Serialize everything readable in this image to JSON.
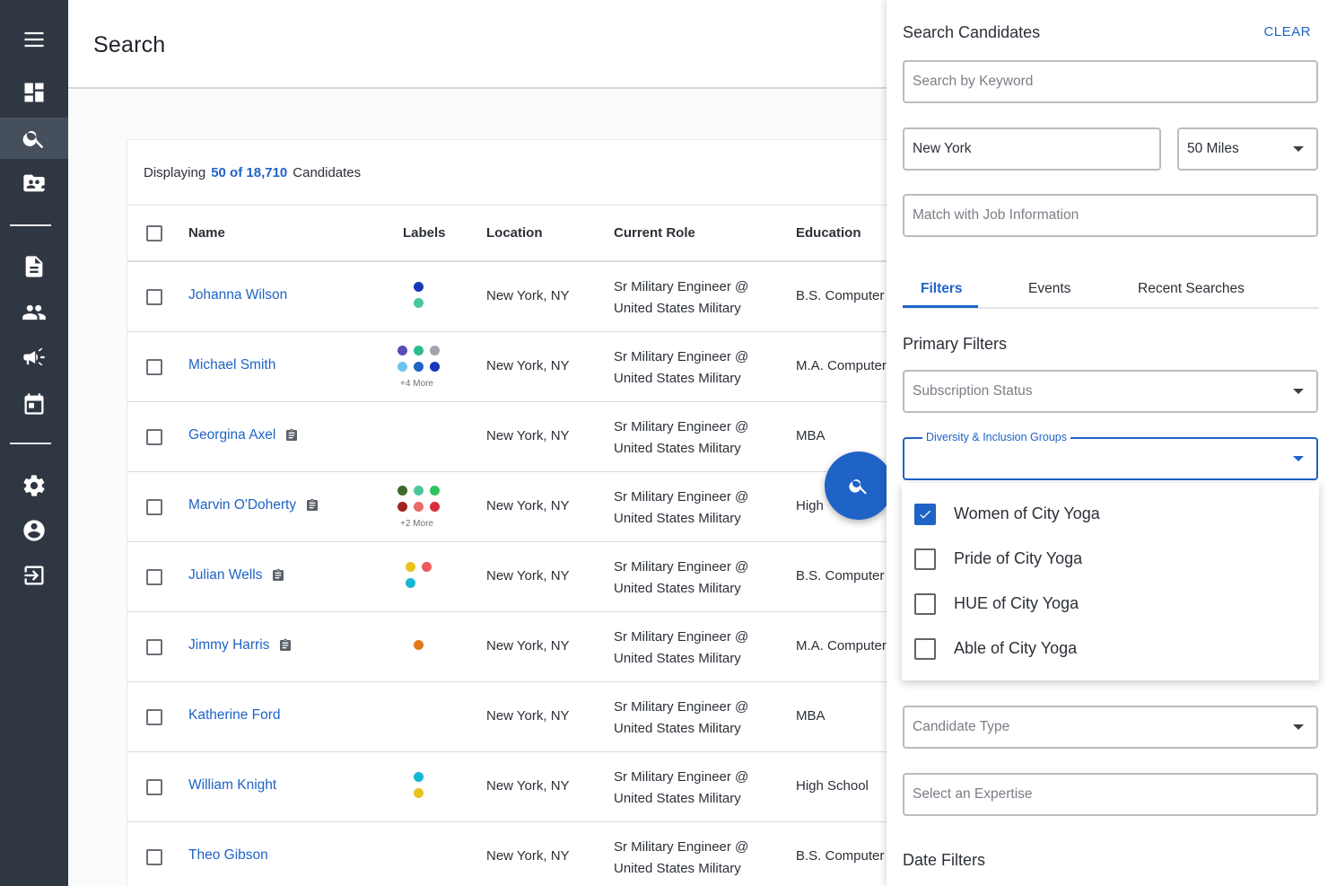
{
  "page": {
    "title": "Search"
  },
  "sidebar": {
    "items": [
      {
        "name": "menu-icon"
      },
      {
        "name": "dashboard-icon"
      },
      {
        "name": "search-icon",
        "active": true
      },
      {
        "name": "folder-people-icon"
      },
      {
        "name": "document-icon"
      },
      {
        "name": "people-icon"
      },
      {
        "name": "megaphone-icon"
      },
      {
        "name": "calendar-icon"
      },
      {
        "name": "gear-icon"
      },
      {
        "name": "account-icon"
      },
      {
        "name": "logout-icon"
      }
    ]
  },
  "table": {
    "displaying_prefix": "Displaying",
    "count": "50 of 18,710",
    "displaying_suffix": "Candidates",
    "headers": {
      "name": "Name",
      "labels": "Labels",
      "location": "Location",
      "role": "Current Role",
      "education": "Education"
    },
    "rows": [
      {
        "name": "Johanna Wilson",
        "note": false,
        "location": "New York, NY",
        "role1": "Sr Military Engineer @",
        "role2": "United States Military",
        "education": "B.S. Computer",
        "labels": [
          "#1838b8",
          "#4bc79a"
        ],
        "more": ""
      },
      {
        "name": "Michael Smith",
        "note": false,
        "location": "New York, NY",
        "role1": "Sr Military Engineer @",
        "role2": "United States Military",
        "education": "M.A. Computer",
        "labels": [
          "#5b4bb7",
          "#2bbd8f",
          "#a3a3ad",
          "#6bc4ee",
          "#1f63c6",
          "#1838b8"
        ],
        "more": "+4 More"
      },
      {
        "name": "Georgina Axel",
        "note": true,
        "location": "New York, NY",
        "role1": "Sr Military Engineer @",
        "role2": "United States Military",
        "education": "MBA",
        "labels": [],
        "more": ""
      },
      {
        "name": "Marvin O'Doherty",
        "note": true,
        "location": "New York, NY",
        "role1": "Sr Military Engineer @",
        "role2": "United States Military",
        "education": "High",
        "labels": [
          "#3c6b2b",
          "#4bc79a",
          "#2ec45e",
          "#a32420",
          "#e86a6a",
          "#d72e3a"
        ],
        "more": "+2 More"
      },
      {
        "name": "Julian Wells",
        "note": true,
        "location": "New York, NY",
        "role1": "Sr Military Engineer @",
        "role2": "United States Military",
        "education": "B.S. Computer",
        "labels": [
          "#e8c21e",
          "#ef5a5a",
          "#18b5d4"
        ],
        "more": ""
      },
      {
        "name": "Jimmy Harris",
        "note": true,
        "location": "New York, NY",
        "role1": "Sr Military Engineer @",
        "role2": "United States Military",
        "education": "M.A. Computer",
        "labels": [
          "#e07a1c"
        ],
        "more": ""
      },
      {
        "name": "Katherine Ford",
        "note": false,
        "location": "New York, NY",
        "role1": "Sr Military Engineer @",
        "role2": "United States Military",
        "education": "MBA",
        "labels": [],
        "more": ""
      },
      {
        "name": "William Knight",
        "note": false,
        "location": "New York, NY",
        "role1": "Sr Military Engineer @",
        "role2": "United States Military",
        "education": "High School",
        "labels": [
          "#18b5d4",
          "#e8c21e"
        ],
        "more": ""
      },
      {
        "name": "Theo Gibson",
        "note": false,
        "location": "New York, NY",
        "role1": "Sr Military Engineer @",
        "role2": "United States Military",
        "education": "B.S. Computer",
        "labels": [],
        "more": ""
      }
    ]
  },
  "panel": {
    "title": "Search Candidates",
    "clear": "CLEAR",
    "keyword_placeholder": "Search by Keyword",
    "location_value": "New York",
    "radius_value": "50 Miles",
    "match_placeholder": "Match with Job Information",
    "tabs": [
      "Filters",
      "Events",
      "Recent Searches"
    ],
    "primary_filters": "Primary Filters",
    "subscription_placeholder": "Subscription Status",
    "diversity_label": "Diversity & Inclusion Groups",
    "diversity_options": [
      {
        "label": "Women of City Yoga",
        "checked": true
      },
      {
        "label": "Pride of City Yoga",
        "checked": false
      },
      {
        "label": "HUE of City Yoga",
        "checked": false
      },
      {
        "label": "Able of City Yoga",
        "checked": false
      }
    ],
    "candidate_type_placeholder": "Candidate Type",
    "expertise_placeholder": "Select an Expertise",
    "date_filters": "Date Filters"
  },
  "colors": {
    "accent": "#1f63c6",
    "sidebar": "#2f3742",
    "sidebar_active": "#46505c"
  }
}
